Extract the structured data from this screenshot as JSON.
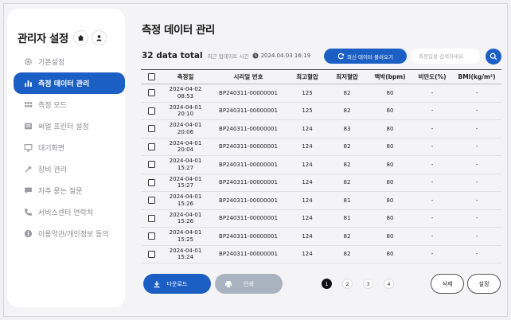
{
  "sidebar": {
    "title": "관리자 설정",
    "items": [
      {
        "label": "기본설정",
        "icon": "gear-icon",
        "active": false
      },
      {
        "label": "측정 데이터 관리",
        "icon": "bar-chart-icon",
        "active": true
      },
      {
        "label": "측정 모드",
        "icon": "grid-icon",
        "active": false
      },
      {
        "label": "써멀 프린터 설정",
        "icon": "printer-icon",
        "active": false
      },
      {
        "label": "대기화면",
        "icon": "monitor-icon",
        "active": false
      },
      {
        "label": "장비 관리",
        "icon": "wrench-icon",
        "active": false
      },
      {
        "label": "자주 묻는 질문",
        "icon": "chat-icon",
        "active": false
      },
      {
        "label": "서비스센터 연락처",
        "icon": "phone-icon",
        "active": false
      },
      {
        "label": "이용약관/개인정보 동의",
        "icon": "info-icon",
        "active": false
      }
    ]
  },
  "main": {
    "title": "측정 데이터 관리",
    "total": "32 data total",
    "update_label": "최근 업데이트 시간",
    "update_time": "2024.04.03 16:19",
    "refresh_label": "최신 데이터 불러오기",
    "search_placeholder": "측정일을 검색하세요."
  },
  "table": {
    "headers": [
      "측정일",
      "시리얼 번호",
      "최고혈압",
      "최저혈압",
      "맥박(bpm)",
      "비만도(%)",
      "BMI(kg/m²)"
    ],
    "rows": [
      {
        "date": "2024-04-02",
        "time": "08:53",
        "serial": "BP240311-00000001",
        "sys": "125",
        "dia": "82",
        "pulse": "80",
        "obesity": "-",
        "bmi": "-"
      },
      {
        "date": "2024-04-01",
        "time": "20:10",
        "serial": "BP240311-00000001",
        "sys": "125",
        "dia": "82",
        "pulse": "80",
        "obesity": "-",
        "bmi": "-"
      },
      {
        "date": "2024-04-01",
        "time": "20:06",
        "serial": "BP240311-00000001",
        "sys": "124",
        "dia": "83",
        "pulse": "80",
        "obesity": "-",
        "bmi": "-"
      },
      {
        "date": "2024-04-01",
        "time": "20:04",
        "serial": "BP240311-00000001",
        "sys": "124",
        "dia": "82",
        "pulse": "80",
        "obesity": "-",
        "bmi": "-"
      },
      {
        "date": "2024-04-01",
        "time": "15:27",
        "serial": "BP240311-00000001",
        "sys": "124",
        "dia": "82",
        "pulse": "80",
        "obesity": "-",
        "bmi": "-"
      },
      {
        "date": "2024-04-01",
        "time": "15:27",
        "serial": "BP240311-00000001",
        "sys": "124",
        "dia": "82",
        "pulse": "80",
        "obesity": "-",
        "bmi": "-"
      },
      {
        "date": "2024-04-01",
        "time": "15:26",
        "serial": "BP240311-00000001",
        "sys": "124",
        "dia": "81",
        "pulse": "80",
        "obesity": "-",
        "bmi": "-"
      },
      {
        "date": "2024-04-01",
        "time": "15:26",
        "serial": "BP240311-00000001",
        "sys": "124",
        "dia": "81",
        "pulse": "80",
        "obesity": "-",
        "bmi": "-"
      },
      {
        "date": "2024-04-01",
        "time": "15:25",
        "serial": "BP240311-00000001",
        "sys": "124",
        "dia": "82",
        "pulse": "80",
        "obesity": "-",
        "bmi": "-"
      },
      {
        "date": "2024-04-01",
        "time": "15:24",
        "serial": "BP240311-00000001",
        "sys": "124",
        "dia": "82",
        "pulse": "80",
        "obesity": "-",
        "bmi": "-"
      }
    ]
  },
  "footer": {
    "download_label": "다운로드",
    "print_label": "인쇄",
    "pages": [
      "1",
      "2",
      "3",
      "4"
    ],
    "current_page": "1",
    "delete_label": "삭제",
    "settings_label": "설정"
  },
  "colors": {
    "accent": "#1c5fc4",
    "disabled": "#a9b3c0"
  }
}
